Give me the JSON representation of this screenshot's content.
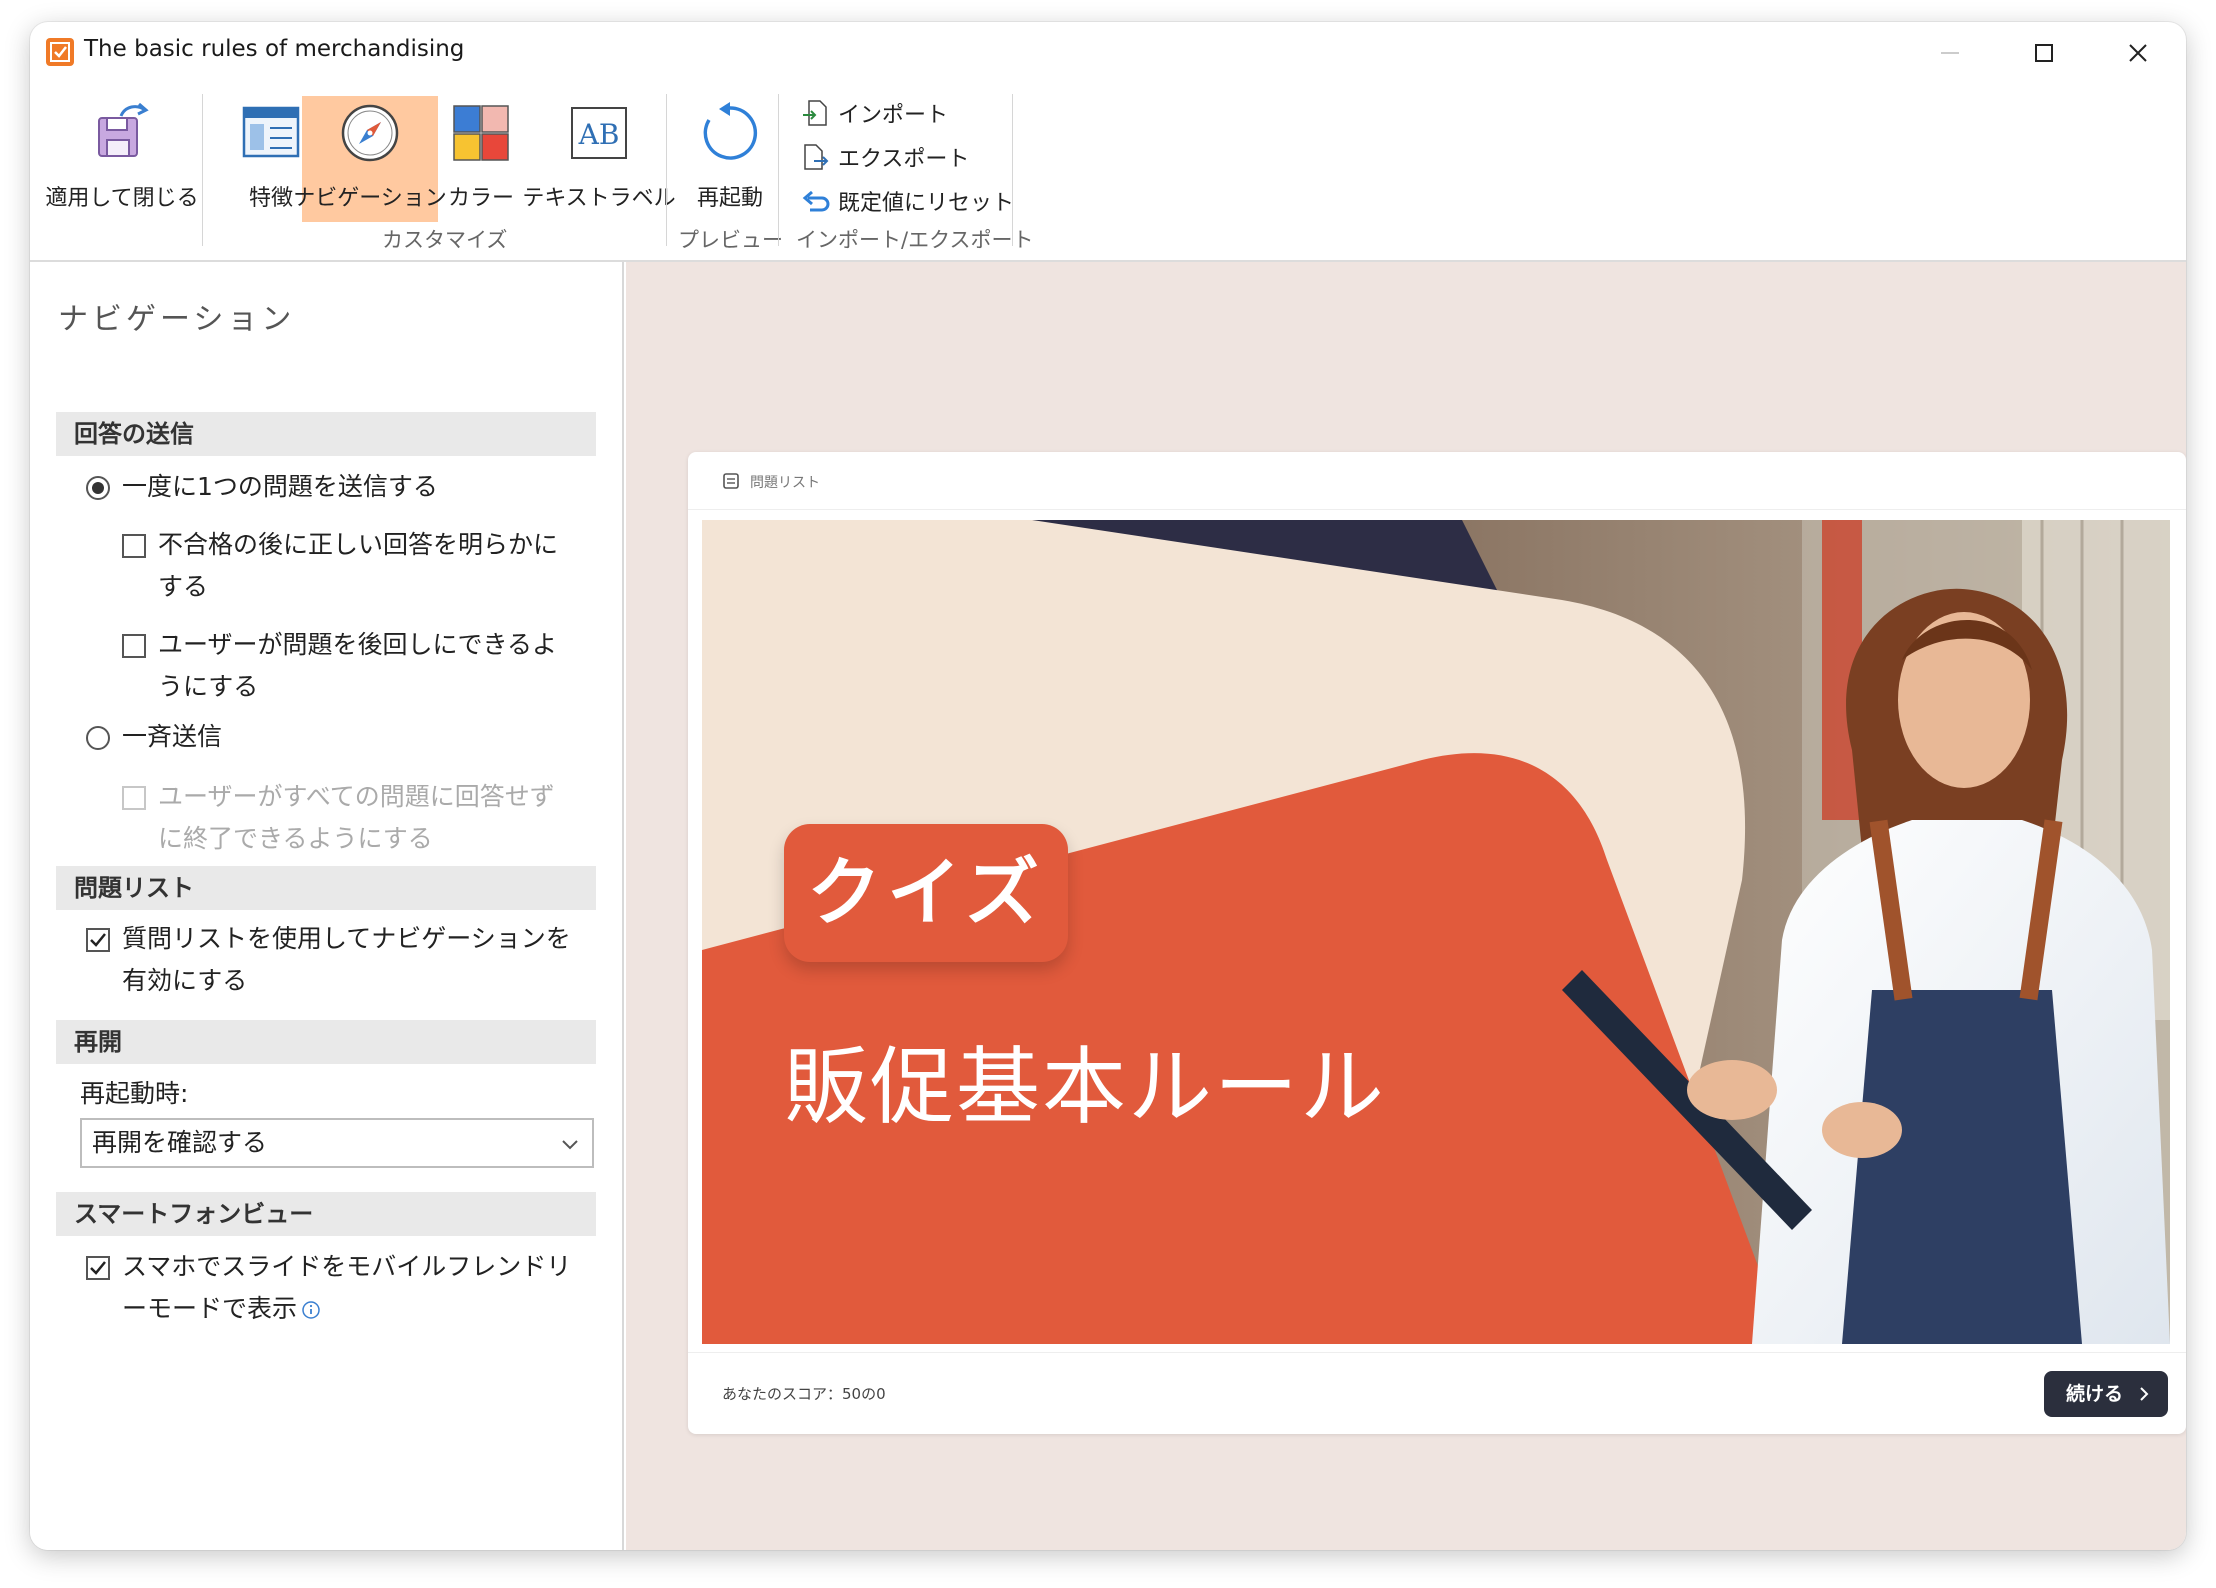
{
  "window": {
    "title": "The basic rules of merchandising"
  },
  "ribbon": {
    "apply_close": "適用して閉じる",
    "feature": "特徴",
    "navigation": "ナビゲーション",
    "color": "カラー",
    "text_label": "テキストラベル",
    "customize_group": "カスタマイズ",
    "restart": "再起動",
    "preview_group": "プレビュー",
    "import": "インポート",
    "export": "エクスポート",
    "reset": "既定値にリセット",
    "import_export_group": "インポート/エクスポート",
    "active_tab": "navigation"
  },
  "panel": {
    "title": "ナビゲーション",
    "sections": {
      "submit": "回答の送信",
      "question_list": "問題リスト",
      "resume": "再開",
      "smartphone": "スマートフォンビュー"
    },
    "submit_one": "一度に1つの問題を送信する",
    "reveal_line1": "不合格の後に正しい回答を明らかに",
    "reveal_line2": "する",
    "skip_line1": "ユーザーが問題を後回しにできるよ",
    "skip_line2": "うにする",
    "submit_all": "一斉送信",
    "finish_line1": "ユーザーがすべての問題に回答せず",
    "finish_line2": "に終了できるようにする",
    "qlist_line1": "質問リストを使用してナビゲーションを",
    "qlist_line2": "有効にする",
    "restart_label": "再起動時:",
    "restart_select": "再開を確認する",
    "mobile_line1": "スマホでスライドをモバイルフレンドリ",
    "mobile_line2": "ーモードで表示",
    "states": {
      "submit_mode": "one",
      "reveal_checked": false,
      "skip_checked": false,
      "finish_checked": false,
      "finish_disabled": true,
      "qlist_checked": true,
      "mobile_checked": true
    }
  },
  "preview": {
    "list_label": "問題リスト",
    "quiz_badge": "クイズ",
    "slide_title": "販促基本ルール",
    "score": "あなたのスコア：50の0",
    "continue": "続ける"
  },
  "colors": {
    "accent": "#ffc9a0",
    "slide_red": "#e15a3c",
    "slide_cream": "#f3e4d5",
    "slide_navy": "#2d2d45",
    "preview_bg": "#efe4e0",
    "button_dark": "#2b2f3d"
  }
}
